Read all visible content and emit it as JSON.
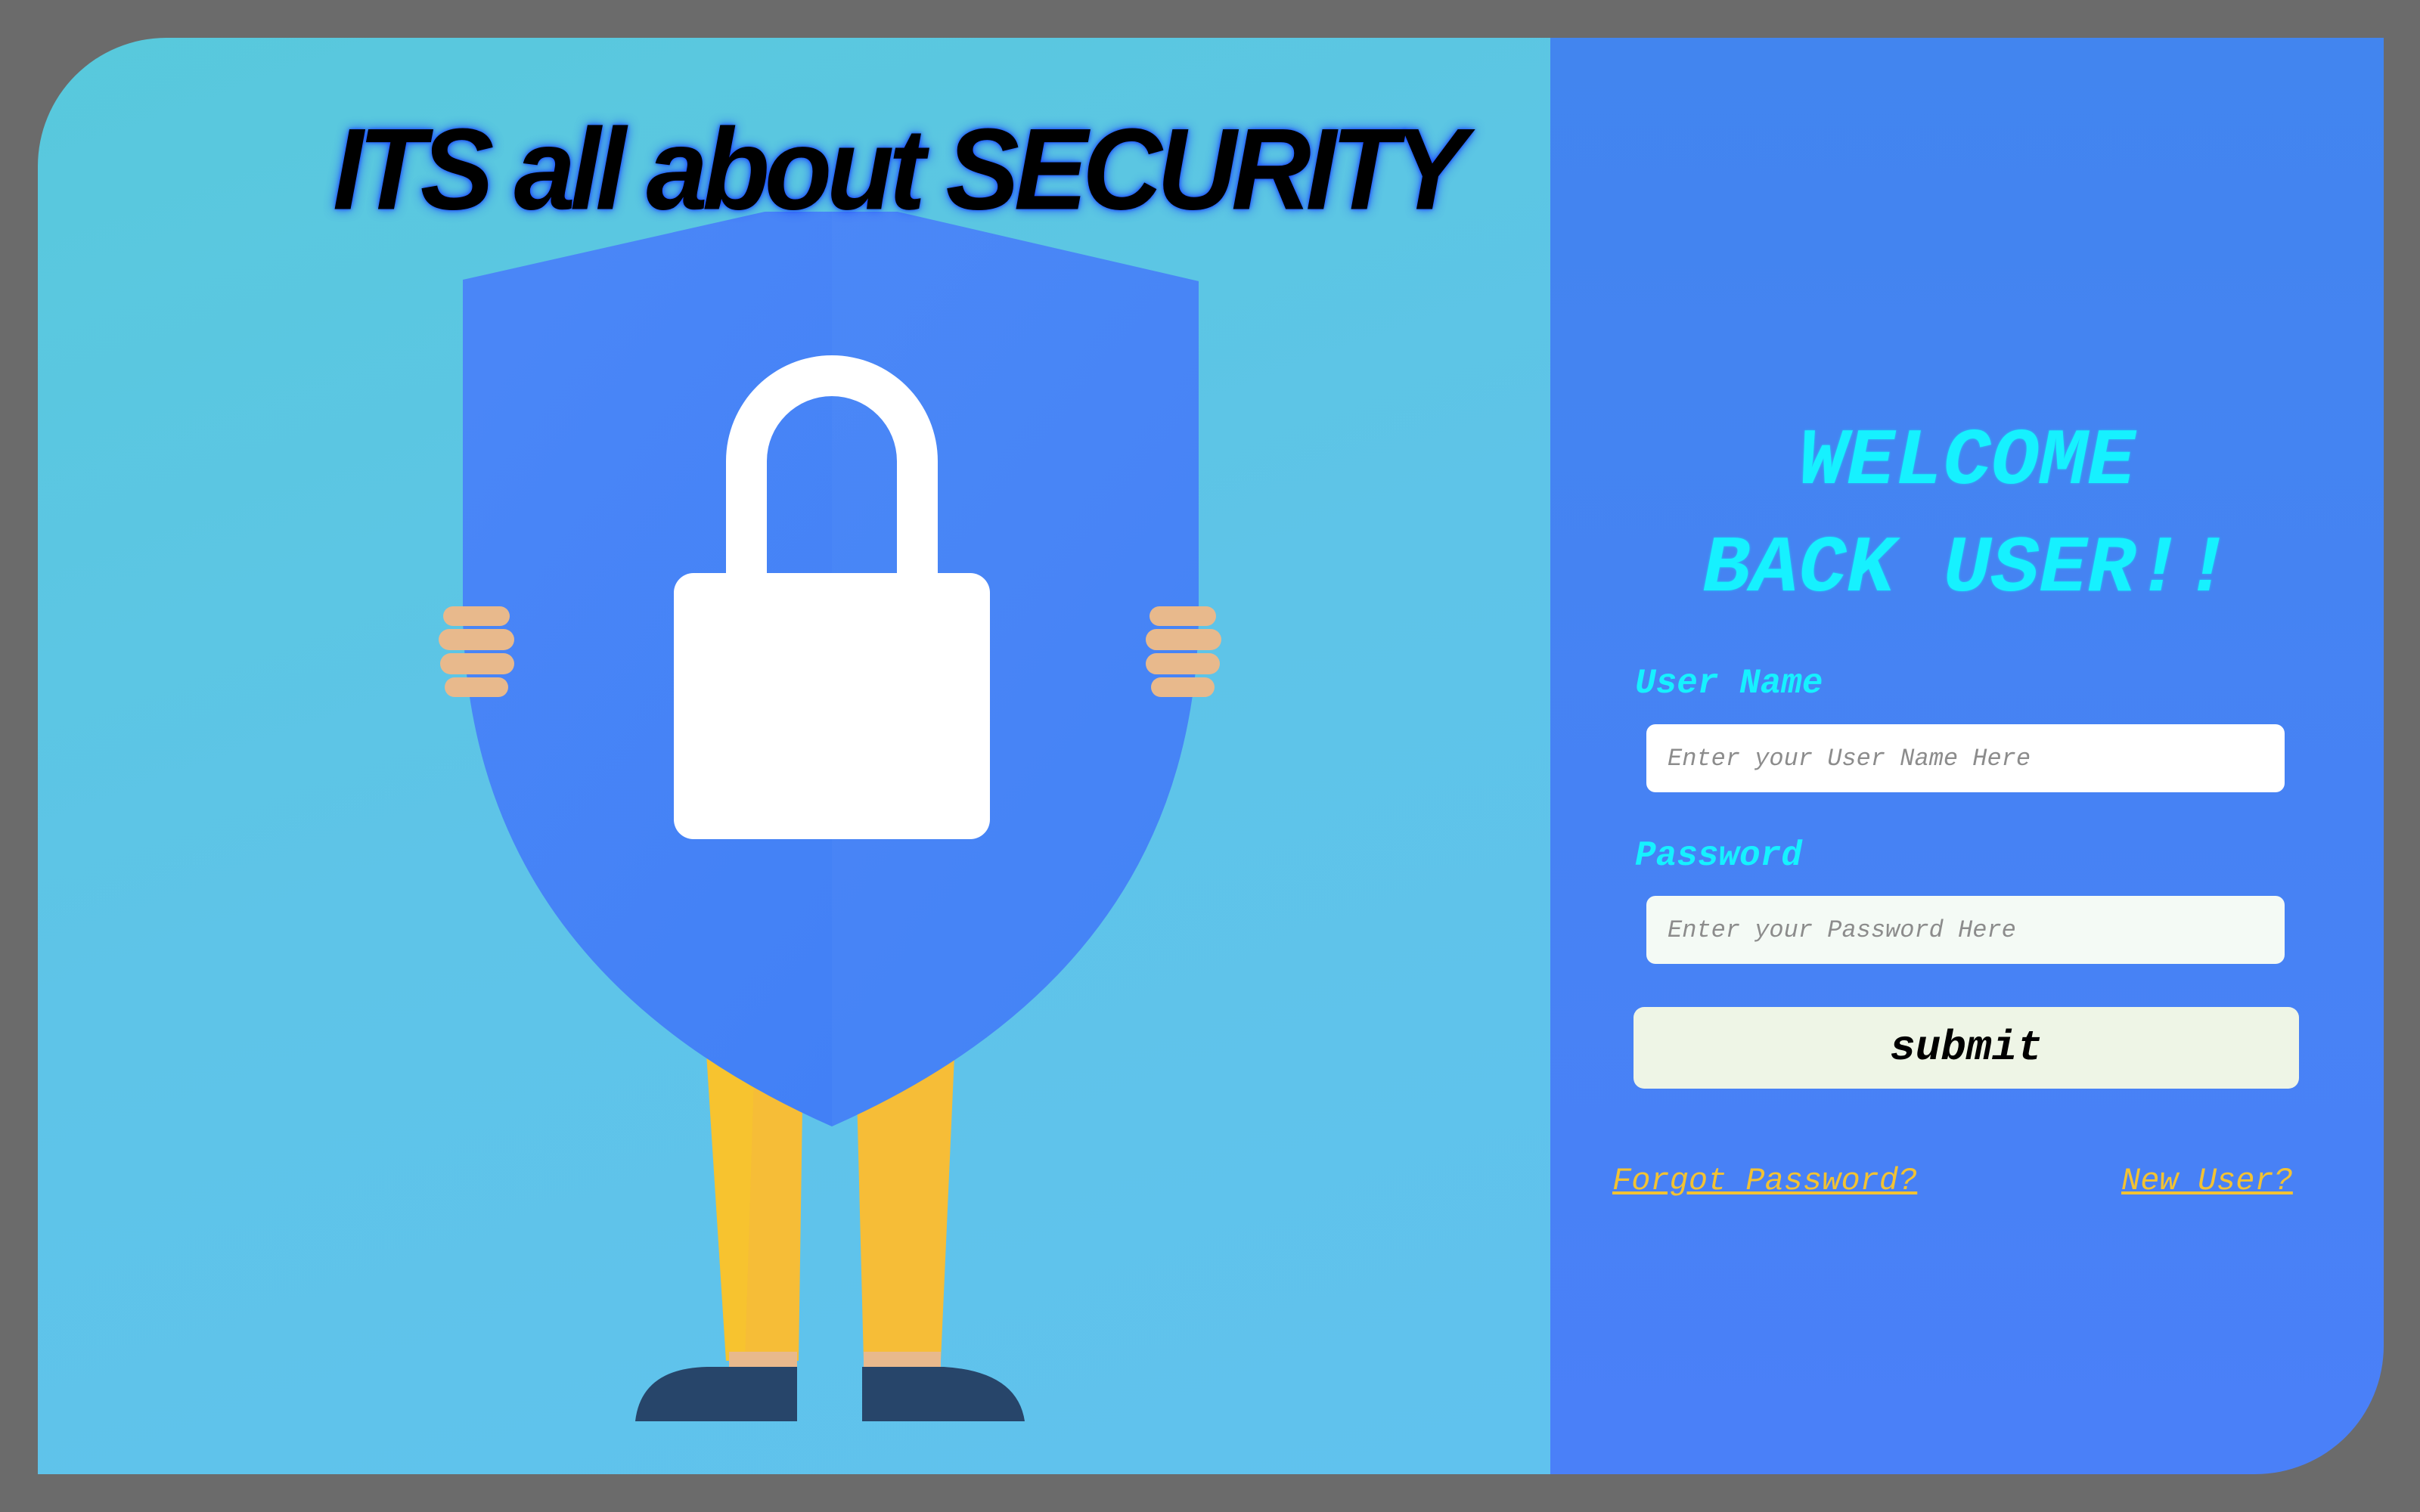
{
  "hero": {
    "title": "ITS all about SECURITY",
    "illustration": "person-holding-shield-with-lock"
  },
  "login": {
    "welcome_line1": "WELCOME",
    "welcome_line2": "BACK USER!!",
    "username_label": "User Name",
    "username_placeholder": "Enter your User Name Here",
    "username_value": "",
    "password_label": "Password",
    "password_placeholder": "Enter your Password Here",
    "password_value": "",
    "submit_label": "submit",
    "forgot_link": "Forgot Password?",
    "new_user_link": "New User?"
  },
  "colors": {
    "page_background": "#6b6b6b",
    "left_panel": "#5ec4e8",
    "right_panel": "#4a80f8",
    "accent_cyan": "#16f1ff",
    "link_yellow": "#f2c233",
    "shield_blue": "#4a86f8"
  }
}
